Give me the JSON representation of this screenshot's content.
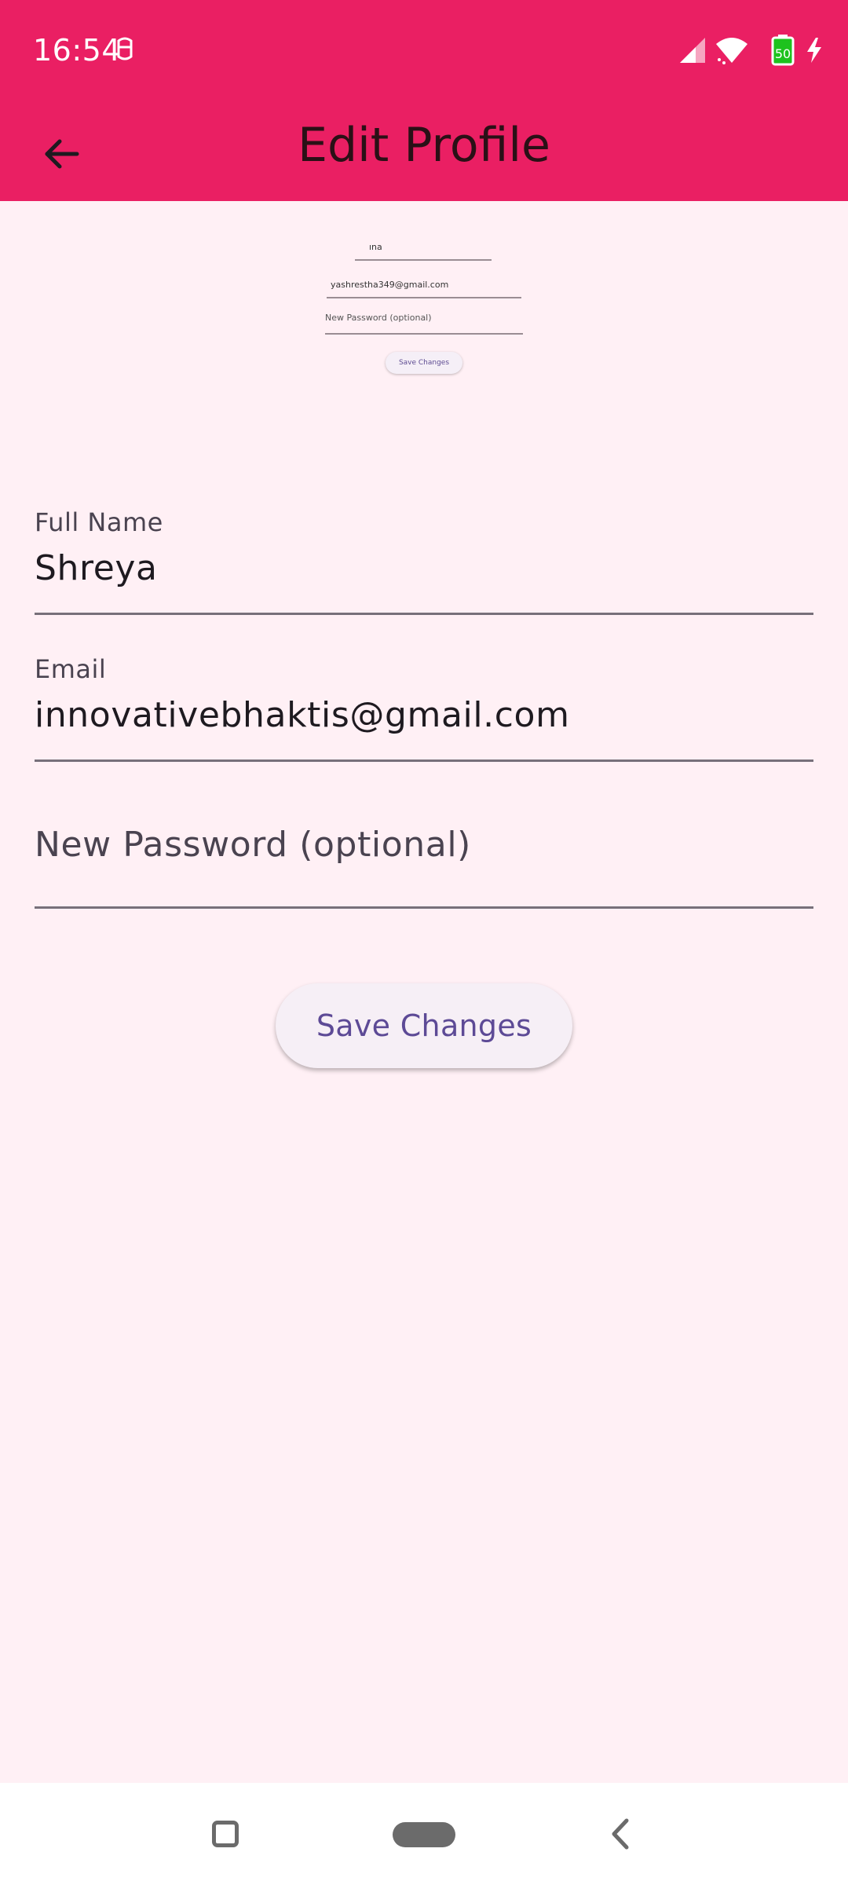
{
  "status_bar": {
    "time": "16:54",
    "battery_level": "50",
    "icons": [
      "notification-icon",
      "signal-icon",
      "wifi-icon",
      "battery-icon",
      "charging-icon"
    ]
  },
  "app_bar": {
    "title": "Edit Profile",
    "back_icon": "arrow-left-icon"
  },
  "preview": {
    "name_value": "ına",
    "email_value": "yashrestha349@gmail.com",
    "password_placeholder": "New Password (optional)",
    "save_label": "Save Changes"
  },
  "form": {
    "full_name": {
      "label": "Full Name",
      "value": "Shreya"
    },
    "email": {
      "label": "Email",
      "value": "innovativebhaktis@gmail.com"
    },
    "new_password": {
      "placeholder": "New Password (optional)"
    },
    "save_label": "Save Changes"
  },
  "colors": {
    "app_bar": "#ea1f63",
    "background": "#fff0f5",
    "button_text": "#5d4a96"
  },
  "nav_bar": {
    "icons": [
      "recents-icon",
      "home-pill-icon",
      "back-chevron-icon"
    ]
  }
}
